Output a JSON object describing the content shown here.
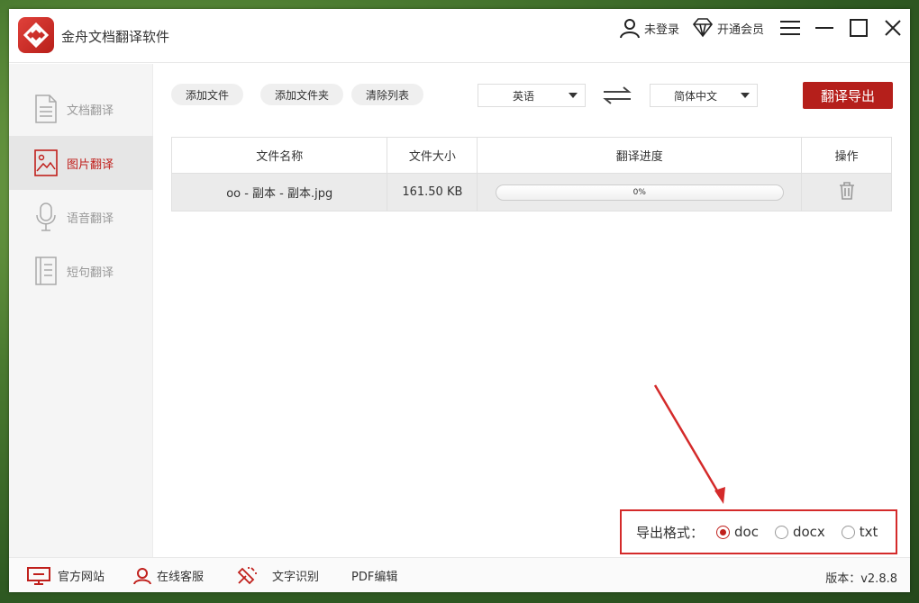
{
  "app": {
    "title": "金舟文档翻译软件",
    "accent": "#b51f1b"
  },
  "header": {
    "login_label": "未登录",
    "vip_label": "开通会员"
  },
  "sidebar": {
    "items": [
      {
        "label": "文档翻译",
        "icon": "document-icon",
        "active": false
      },
      {
        "label": "图片翻译",
        "icon": "image-icon",
        "active": true
      },
      {
        "label": "语音翻译",
        "icon": "microphone-icon",
        "active": false
      },
      {
        "label": "短句翻译",
        "icon": "notes-icon",
        "active": false
      }
    ]
  },
  "toolbar": {
    "add_file": "添加文件",
    "add_folder": "添加文件夹",
    "clear_list": "清除列表",
    "source_lang": "英语",
    "target_lang": "简体中文",
    "export_button": "翻译导出"
  },
  "table": {
    "headers": [
      "文件名称",
      "文件大小",
      "翻译进度",
      "操作"
    ],
    "rows": [
      {
        "name": "oo - 副本 - 副本.jpg",
        "size": "161.50 KB",
        "progress": 0,
        "progress_text": "0%"
      }
    ]
  },
  "export_format": {
    "label": "导出格式：",
    "options": [
      "doc",
      "docx",
      "txt"
    ],
    "selected": "doc"
  },
  "footer": {
    "website": "官方网站",
    "support": "在线客服",
    "ocr": "文字识别",
    "pdf": "PDF编辑",
    "version": "版本：v2.8.8"
  }
}
